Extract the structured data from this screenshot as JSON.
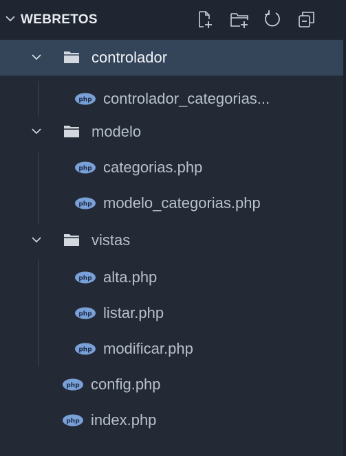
{
  "explorer": {
    "title": "WEBRETOS",
    "actions": [
      "new-file-icon",
      "new-folder-icon",
      "refresh-icon",
      "collapse-all-icon"
    ]
  },
  "tree": {
    "controlador": {
      "label": "controlador",
      "files": [
        "controlador_categorias..."
      ]
    },
    "modelo": {
      "label": "modelo",
      "files": [
        "categorias.php",
        "modelo_categorias.php"
      ]
    },
    "vistas": {
      "label": "vistas",
      "files": [
        "alta.php",
        "listar.php",
        "modificar.php"
      ]
    },
    "root_files": [
      "config.php",
      "index.php"
    ]
  },
  "colors": {
    "background": "#232a35",
    "selection": "#344459",
    "php_icon": "#7aa0d8"
  }
}
